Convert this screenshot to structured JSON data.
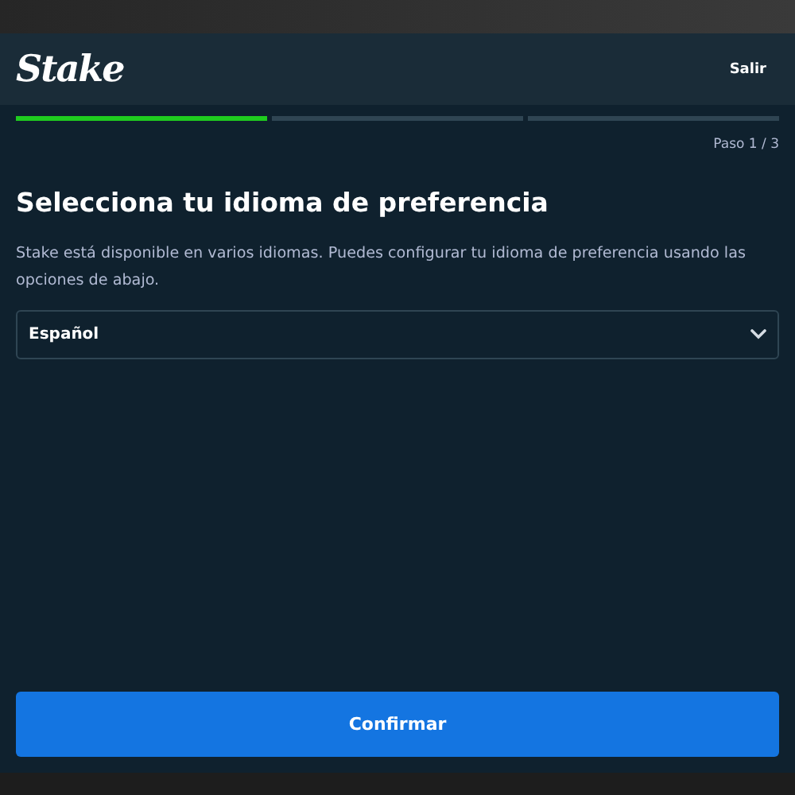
{
  "header": {
    "logo": "Stake",
    "exit_link": "Salir"
  },
  "steps": [
    {
      "done": true
    },
    {
      "done": false
    },
    {
      "done": false
    }
  ],
  "step_label": "Paso 1 / 3",
  "title": "Selecciona tu idioma de preferencia",
  "description": "Stake está disponible en varios idiomas. Puedes configurar tu idioma de preferencia usando las opciones de abajo.",
  "language_select": {
    "value": "Español"
  },
  "confirm_button": "Confirmar"
}
